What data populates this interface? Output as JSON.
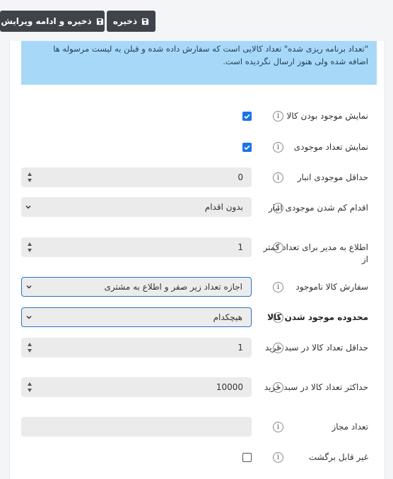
{
  "toolbar": {
    "save_continue_label": "ذخیره و ادامه ویرایش",
    "save_label": "ذخیره"
  },
  "notice": {
    "line1": "\"تعداد برنامه ریزی شده\" تعداد کالایی است که سفارش داده شده و قبلن به لیست مرسوله ها",
    "line2": "اضافه شده ولی هنوز ارسال نگردیده است."
  },
  "fields": {
    "show_availability": {
      "label": "نمایش موجود بودن کالا",
      "checked": true
    },
    "show_stock_quantity": {
      "label": "نمایش تعداد موجودی",
      "checked": true
    },
    "min_stock": {
      "label": "حداقل موجودی انبار",
      "value": "0"
    },
    "low_stock_action": {
      "label": "اقدام کم شدن موجودی انبار",
      "value": "بدون اقدام"
    },
    "notify_admin": {
      "label": "اطلاع به مدیر برای تعداد کمتر از",
      "value": "1"
    },
    "backorders": {
      "label": "سفارش کالا ناموجود",
      "value": "اجازه تعداد زیر صفر و اطلاع به مشتری"
    },
    "out_of_stock_range": {
      "label": "محدوده موجود شدن کالا",
      "value": "هیچکدام"
    },
    "min_cart_qty": {
      "label": "حداقل تعداد کالا در سبد خرید",
      "value": "1"
    },
    "max_cart_qty": {
      "label": "حداکثر تعداد کالا در سبد خرید",
      "value": "10000"
    },
    "allowed_qty": {
      "label": "تعداد مجاز",
      "value": ""
    },
    "not_returnable": {
      "label": "غیر قابل برگشت",
      "checked": false
    }
  },
  "icons": {
    "save": "floppy-disk-icon",
    "help": "info-circle-icon",
    "check": "check-icon",
    "dropdown": "chevron-down-icon",
    "stepper": "stepper-arrows-icon"
  },
  "colors": {
    "button_bg": "#3f444b",
    "notice_bg": "#a8d8f8",
    "checkbox_on": "#1a73e8",
    "focus_border": "#2a71c9"
  }
}
